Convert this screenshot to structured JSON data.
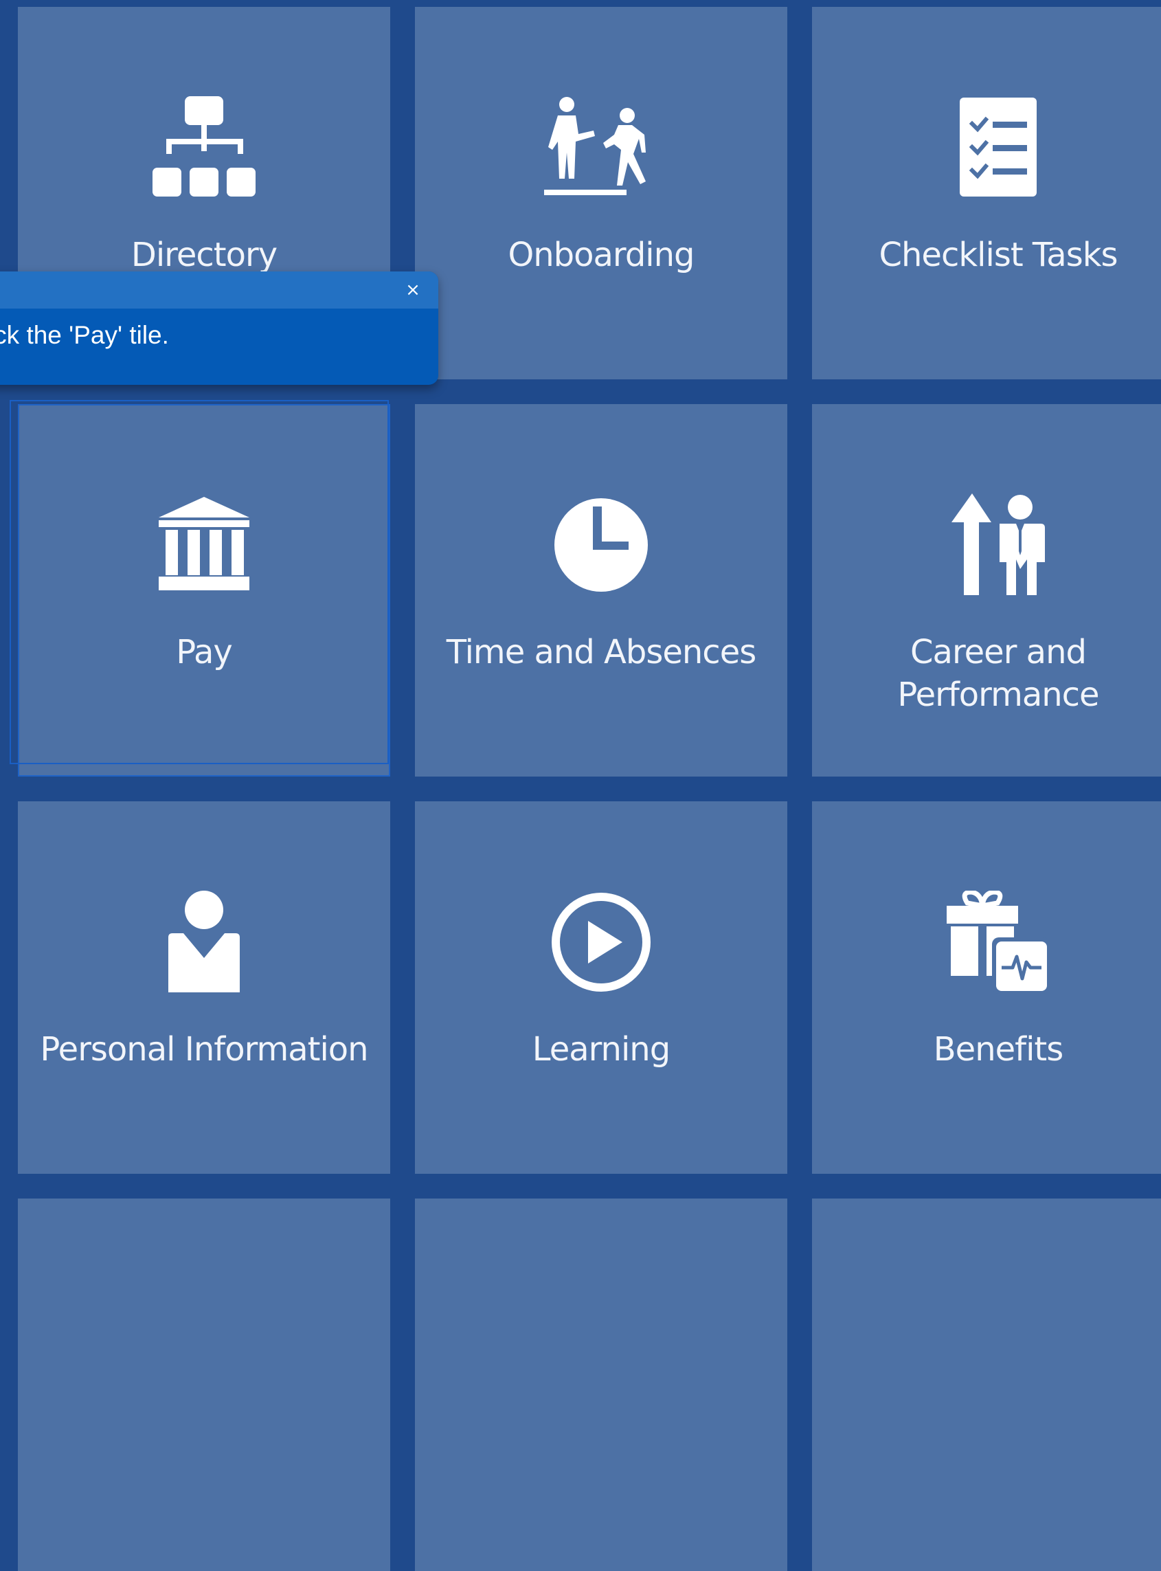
{
  "tiles": [
    {
      "label": "Directory",
      "icon": "org-chart-icon"
    },
    {
      "label": "Onboarding",
      "icon": "onboarding-people-icon"
    },
    {
      "label": "Checklist Tasks",
      "icon": "checklist-icon"
    },
    {
      "label": "Pay",
      "icon": "bank-building-icon"
    },
    {
      "label": "Time and Absences",
      "icon": "clock-icon"
    },
    {
      "label": "Career and Performance",
      "icon": "career-growth-icon"
    },
    {
      "label": "Personal Information",
      "icon": "person-icon"
    },
    {
      "label": "Learning",
      "icon": "play-circle-icon"
    },
    {
      "label": "Benefits",
      "icon": "gift-health-icon"
    }
  ],
  "popup": {
    "text": "Click the 'Pay' tile.",
    "close_label": "×"
  },
  "colors": {
    "background": "#1f4a8c",
    "tile": "#4d71a5",
    "popup": "#045ab6",
    "popup_header": "#2371c3"
  }
}
